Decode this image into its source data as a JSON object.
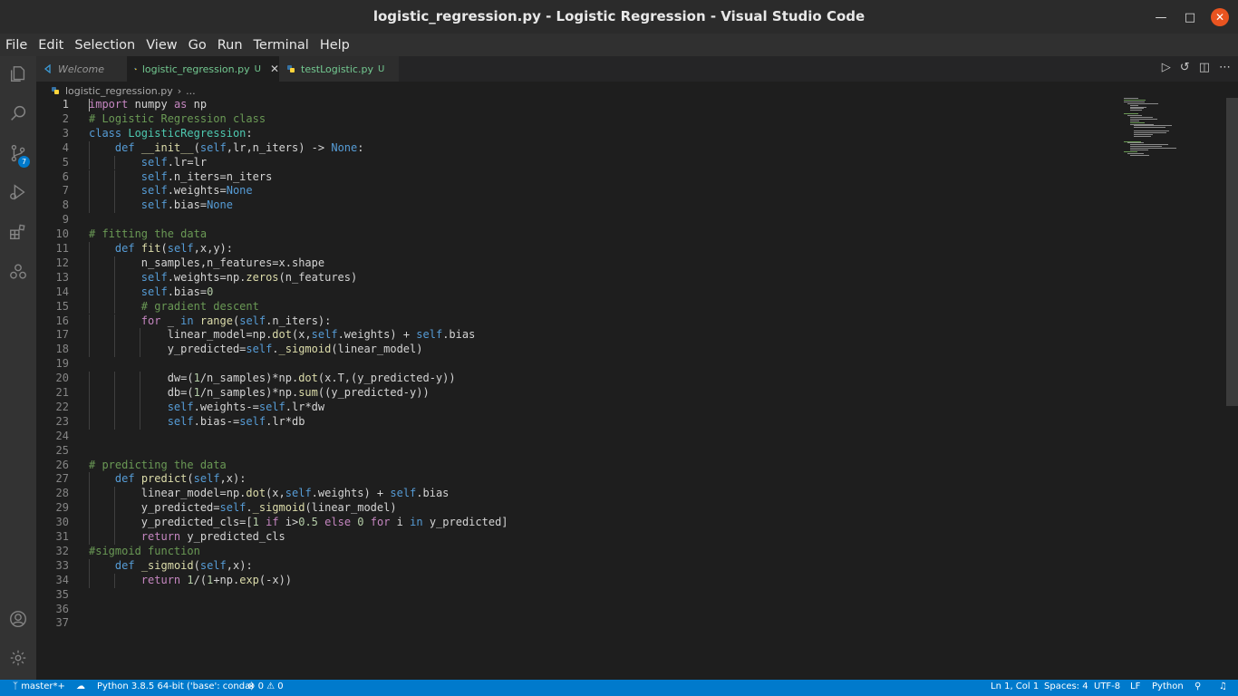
{
  "window": {
    "title": "logistic_regression.py - Logistic Regression - Visual Studio Code"
  },
  "menu": [
    "File",
    "Edit",
    "Selection",
    "View",
    "Go",
    "Run",
    "Terminal",
    "Help"
  ],
  "activity": {
    "scm_badge": "7"
  },
  "tabs": [
    {
      "label": "Welcome",
      "modified": ""
    },
    {
      "label": "logistic_regression.py",
      "modified": "U"
    },
    {
      "label": "testLogistic.py",
      "modified": "U"
    }
  ],
  "breadcrumb": {
    "file": "logistic_regression.py",
    "rest": "..."
  },
  "code_lines": [
    "import numpy as np",
    "# Logistic Regression class",
    "class LogisticRegression:",
    "    def __init__(self,lr,n_iters) -> None:",
    "        self.lr=lr",
    "        self.n_iters=n_iters",
    "        self.weights=None",
    "        self.bias=None",
    "",
    "# fitting the data",
    "    def fit(self,x,y):",
    "        n_samples,n_features=x.shape",
    "        self.weights=np.zeros(n_features)",
    "        self.bias=0",
    "        # gradient descent",
    "        for _ in range(self.n_iters):",
    "            linear_model=np.dot(x,self.weights) + self.bias",
    "            y_predicted=self._sigmoid(linear_model)",
    "",
    "            dw=(1/n_samples)*np.dot(x.T,(y_predicted-y))",
    "            db=(1/n_samples)*np.sum((y_predicted-y))",
    "            self.weights-=self.lr*dw",
    "            self.bias-=self.lr*db",
    "",
    "",
    "# predicting the data",
    "    def predict(self,x):",
    "        linear_model=np.dot(x,self.weights) + self.bias",
    "        y_predicted=self._sigmoid(linear_model)",
    "        y_predicted_cls=[1 if i>0.5 else 0 for i in y_predicted]",
    "        return y_predicted_cls",
    "#sigmoid function",
    "    def _sigmoid(self,x):",
    "        return 1/(1+np.exp(-x))",
    "",
    "",
    ""
  ],
  "status": {
    "branch": "master*+",
    "interpreter": "Python 3.8.5 64-bit ('base': conda)",
    "errors": "0",
    "warnings": "0",
    "position": "Ln 1, Col 1",
    "spaces": "Spaces: 4",
    "encoding": "UTF-8",
    "eol": "LF",
    "language": "Python"
  },
  "colors": {
    "keyword": "#569cd6",
    "control": "#c586c0",
    "comment": "#6a9955",
    "function": "#dcdcaa",
    "class": "#4ec9b0",
    "number": "#b5cea8",
    "variable": "#9cdcfe",
    "text": "#d4d4d4",
    "accent": "#007acc"
  }
}
